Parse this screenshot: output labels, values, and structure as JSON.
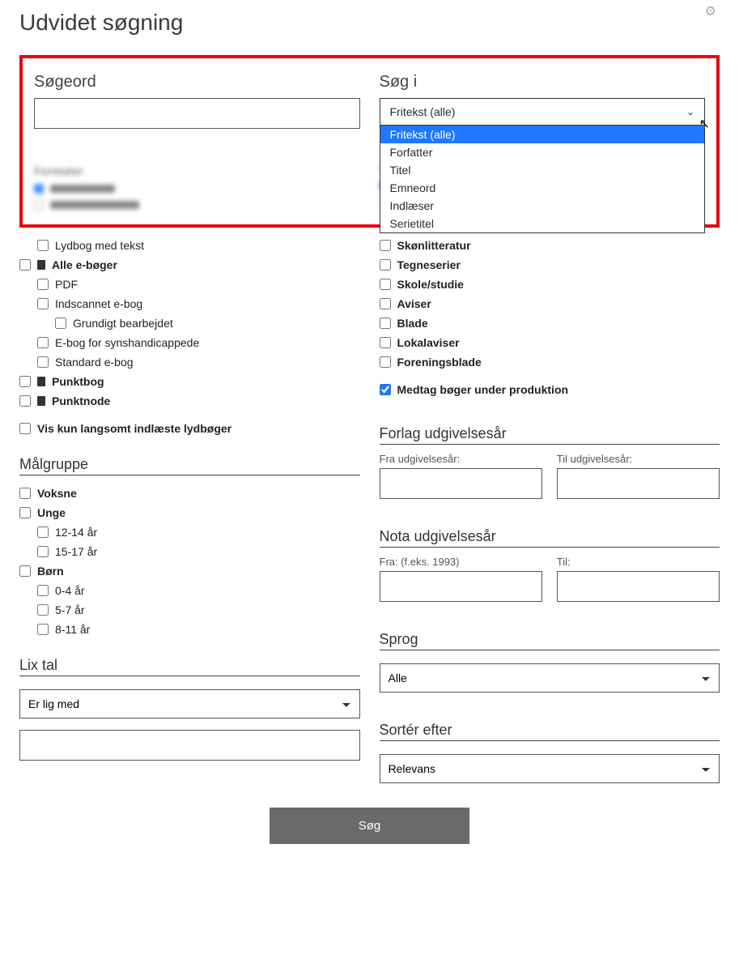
{
  "page_title": "Udvidet søgning",
  "sogeord_label": "Søgeord",
  "sog_i": {
    "label": "Søg i",
    "selected": "Fritekst (alle)",
    "options": [
      "Fritekst (alle)",
      "Forfatter",
      "Titel",
      "Emneord",
      "Indlæser",
      "Serietitel"
    ]
  },
  "formats": {
    "lydbog_tekst": "Lydbog med tekst",
    "alle_eboger": "Alle e-bøger",
    "pdf": "PDF",
    "indscannet": "Indscannet e-bog",
    "grundigt": "Grundigt bearbejdet",
    "ebog_syns": "E-bog for synshandicappede",
    "standard_ebog": "Standard e-bog",
    "punktbog": "Punktbog",
    "punktnode": "Punktnode",
    "vis_kun_langsomt": "Vis kun langsomt indlæste lydbøger"
  },
  "kategorier": {
    "skonlitteratur": "Skønlitteratur",
    "tegneserier": "Tegneserier",
    "skole_studie": "Skole/studie",
    "aviser": "Aviser",
    "blade": "Blade",
    "lokalaviser": "Lokalaviser",
    "foreningsblade": "Foreningsblade",
    "medtag_produktion": "Medtag bøger under produktion"
  },
  "malgruppe": {
    "title": "Målgruppe",
    "voksne": "Voksne",
    "unge": "Unge",
    "u_12_14": "12-14 år",
    "u_15_17": "15-17 år",
    "born": "Børn",
    "b_0_4": "0-4 år",
    "b_5_7": "5-7 år",
    "b_8_11": "8-11 år"
  },
  "lix": {
    "title": "Lix tal",
    "operator": "Er lig med"
  },
  "forlag": {
    "title": "Forlag udgivelsesår",
    "fra": "Fra udgivelsesår:",
    "til": "Til udgivelsesår:"
  },
  "nota": {
    "title": "Nota udgivelsesår",
    "fra": "Fra: (f.eks. 1993)",
    "til": "Til:"
  },
  "sprog": {
    "title": "Sprog",
    "selected": "Alle"
  },
  "sorter": {
    "title": "Sortér efter",
    "selected": "Relevans"
  },
  "submit": "Søg"
}
